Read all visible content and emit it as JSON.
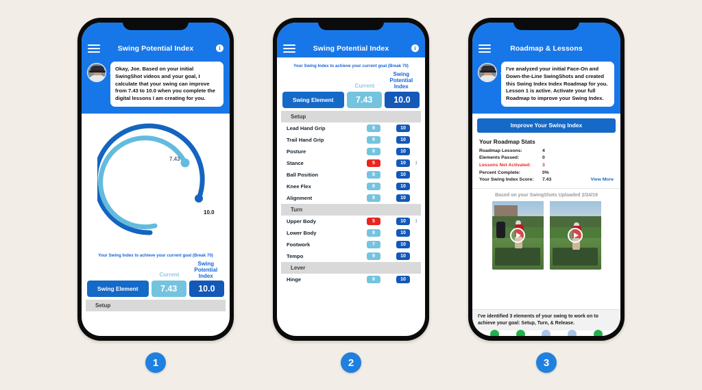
{
  "background_color": "#F2EEE7",
  "accent_blue": "#1569C7",
  "light_blue": "#74C3DF",
  "alert_red": "#E8241F",
  "phone1": {
    "step_number": "1",
    "appbar": {
      "title": "Swing Potential Index",
      "menu_icon": "hamburger-icon",
      "info_icon": "info-icon"
    },
    "chat": {
      "message": "Okay, Joe. Based on your initial SwingShot videos and your goal, I calculate that your swing can improve from 7.43 to 10.0 when you complete the digital lessons I am creating for you."
    },
    "gauge": {
      "current_label": "7.43",
      "goal_label": "10.0",
      "current_value": 7.43,
      "goal_value": 10.0
    },
    "goal_note": "Your Swing Index to achieve your current goal (Break 70)",
    "columns": {
      "current": "Current",
      "potential": "Swing Potential Index"
    },
    "index_row": {
      "label": "Swing Element",
      "current": "7.43",
      "goal": "10.0"
    },
    "next_section": "Setup"
  },
  "phone2": {
    "step_number": "2",
    "appbar": {
      "title": "Swing Potential Index",
      "menu_icon": "hamburger-icon",
      "info_icon": "info-icon"
    },
    "goal_note": "Your Swing Index to achieve your current goal (Break 70)",
    "columns": {
      "current": "Current",
      "potential": "Swing Potential Index"
    },
    "index_row": {
      "label": "Swing Element",
      "current": "7.43",
      "goal": "10.0"
    },
    "sections": [
      {
        "name": "Setup",
        "rows": [
          {
            "name": "Lead Hand Grip",
            "current": "8",
            "goal": "10",
            "status": "ok",
            "arrow": false
          },
          {
            "name": "Trail Hand Grip",
            "current": "9",
            "goal": "10",
            "status": "ok",
            "arrow": false
          },
          {
            "name": "Posture",
            "current": "8",
            "goal": "10",
            "status": "ok",
            "arrow": false
          },
          {
            "name": "Stance",
            "current": "5",
            "goal": "10",
            "status": "bad",
            "arrow": true
          },
          {
            "name": "Ball Position",
            "current": "8",
            "goal": "10",
            "status": "ok",
            "arrow": false
          },
          {
            "name": "Knee Flex",
            "current": "8",
            "goal": "10",
            "status": "ok",
            "arrow": false
          },
          {
            "name": "Alignment",
            "current": "8",
            "goal": "10",
            "status": "ok",
            "arrow": false
          }
        ]
      },
      {
        "name": "Turn",
        "rows": [
          {
            "name": "Upper Body",
            "current": "5",
            "goal": "10",
            "status": "bad",
            "arrow": true
          },
          {
            "name": "Lower Body",
            "current": "8",
            "goal": "10",
            "status": "ok",
            "arrow": false
          },
          {
            "name": "Footwork",
            "current": "7",
            "goal": "10",
            "status": "ok",
            "arrow": false
          },
          {
            "name": "Tempo",
            "current": "9",
            "goal": "10",
            "status": "ok",
            "arrow": false
          }
        ]
      },
      {
        "name": "Lever",
        "rows": [
          {
            "name": "Hinge",
            "current": "8",
            "goal": "10",
            "status": "ok",
            "arrow": false
          }
        ]
      }
    ]
  },
  "phone3": {
    "step_number": "3",
    "appbar": {
      "title": "Roadmap & Lessons",
      "menu_icon": "hamburger-icon"
    },
    "chat": {
      "message": "I've analyzed your initial Face-On and Down-the-Line SwingShots and created this Swing Index Index Roadmap for you. Lesson 1 is active. Activate your full Roadmap to improve your Swing Index."
    },
    "cta_label": "Improve Your Swing Index",
    "stats": {
      "title": "Your Roadmap Stats",
      "view_more": "View More",
      "rows": [
        {
          "key": "Roadmap Lessons:",
          "value": "4",
          "alert": false
        },
        {
          "key": "Elements Passed:",
          "value": "0",
          "alert": false
        },
        {
          "key": "Lessons Not Activated:",
          "value": "3",
          "alert": true
        },
        {
          "key": "Percent Complete:",
          "value": "0%",
          "alert": false
        },
        {
          "key": "Your Swing Index Score:",
          "value": "7.43",
          "alert": false
        }
      ]
    },
    "based_on": "Based on your SwingShots Uploaded 2/24/19",
    "videos": [
      {
        "caption": "face-on-swing-video",
        "play_icon": "play-icon"
      },
      {
        "caption": "down-the-line-swing-video",
        "play_icon": "play-icon"
      }
    ],
    "footnote": "I've identified 3 elements of your swing to work on to achieve your goal: Setup, Turn, & Release.",
    "dot_colors": [
      "#23B14D",
      "#23B14D",
      "#A9C6E8",
      "#A9C6E8",
      "#23B14D"
    ]
  }
}
